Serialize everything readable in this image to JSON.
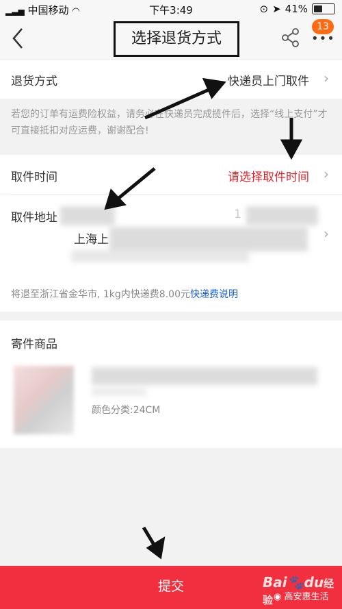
{
  "status_bar": {
    "carrier": "中国移动",
    "time": "下午3:49",
    "battery": "41%"
  },
  "nav": {
    "title": "选择退货方式",
    "badge": "13"
  },
  "return_method": {
    "label": "退货方式",
    "value": "快递员上门取件",
    "note": "若您的订单有运费险权益，请务必在快递员完成揽件后，选择“线上支付”才可直接抵扣对应运费，谢谢配合!"
  },
  "pickup_time": {
    "label": "取件时间",
    "value": "请选择取件时间"
  },
  "pickup_address": {
    "label": "取件地址",
    "city": "上海上",
    "phone_prefix": "1"
  },
  "shipping_info": {
    "text": "将退至浙江省金华市, 1kg内快递费8.00元",
    "link": "快递费说明"
  },
  "goods": {
    "label": "寄件商品",
    "spec": "颜色分类:24CM"
  },
  "submit": {
    "label": "提交"
  },
  "watermark": {
    "brand": "Bai",
    "brand2": "du",
    "jingyan": "经验",
    "account": "高安惠生活"
  }
}
